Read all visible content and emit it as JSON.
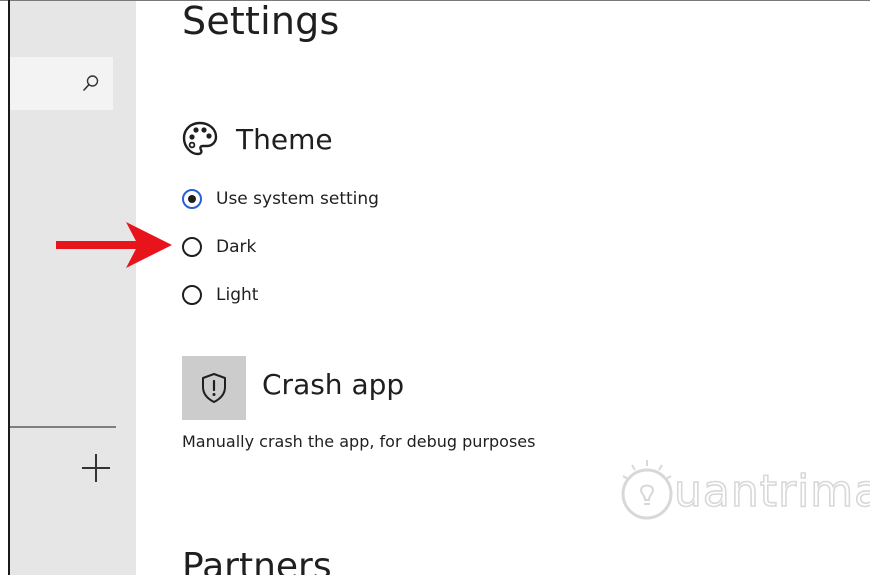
{
  "page": {
    "title": "Settings"
  },
  "sidebar": {
    "search_icon": "search-icon",
    "add_icon": "plus-icon"
  },
  "theme_section": {
    "icon": "palette-icon",
    "title": "Theme",
    "options": [
      {
        "label": "Use system setting",
        "selected": true
      },
      {
        "label": "Dark",
        "selected": false
      },
      {
        "label": "Light",
        "selected": false
      }
    ]
  },
  "crash_section": {
    "icon": "shield-alert-icon",
    "title": "Crash app",
    "description": "Manually crash the app, for debug purposes"
  },
  "partners_section": {
    "title": "Partners"
  },
  "annotation": {
    "icon": "red-arrow-icon",
    "color": "#e8141b"
  },
  "watermark": {
    "icon": "lightbulb-icon",
    "text": "uantrimang"
  },
  "colors": {
    "sidebar_bg": "#e6e6e6",
    "search_bg": "#f3f3f3",
    "radio_selected_ring": "#2b5fd9",
    "crash_tile_bg": "#cccccc"
  }
}
